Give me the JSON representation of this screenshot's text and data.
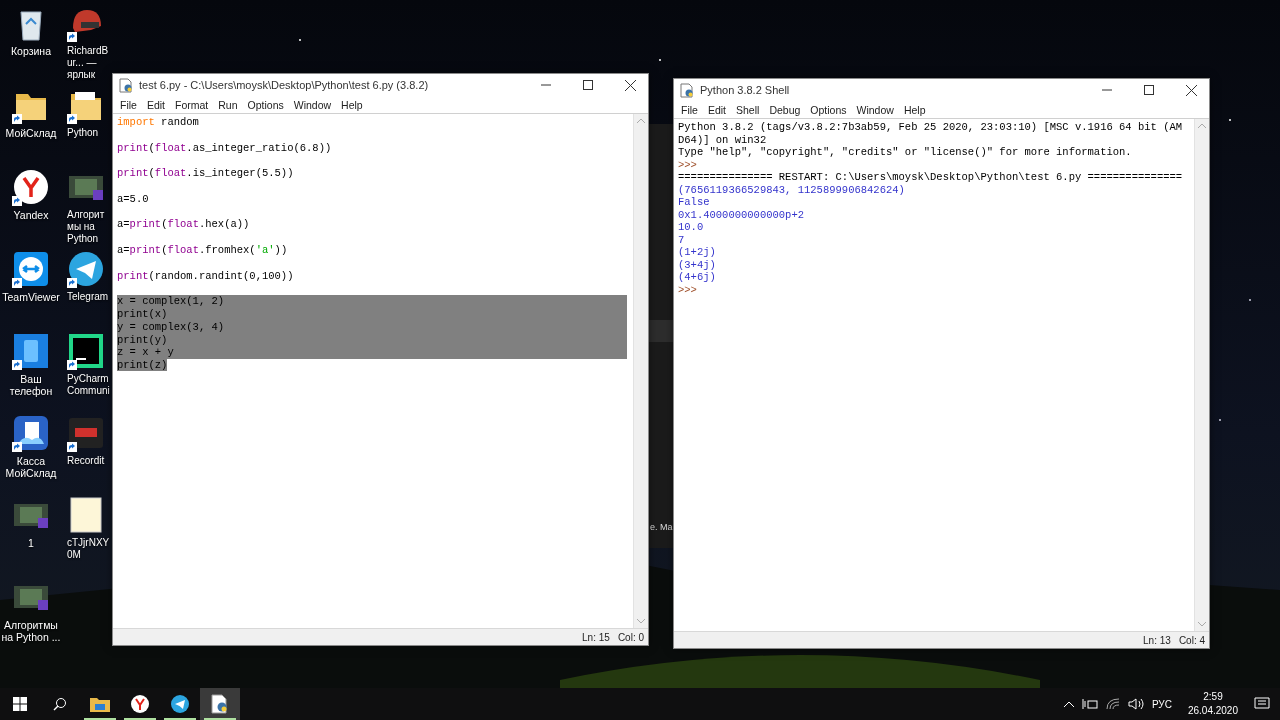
{
  "desktop": {
    "icons": [
      {
        "label": "Корзина",
        "shortcut": false
      },
      {
        "label": "МойСклад",
        "shortcut": true
      },
      {
        "label": "Yandex",
        "shortcut": true
      },
      {
        "label": "TeamViewer",
        "shortcut": true
      },
      {
        "label": "Ваш телефон",
        "shortcut": true
      },
      {
        "label": "Касса МойСклад",
        "shortcut": true
      },
      {
        "label": "1",
        "shortcut": false
      },
      {
        "label": "Алгоритмы на Python ...",
        "shortcut": false
      },
      {
        "label": "RichardBur... — ярлык",
        "shortcut": true
      },
      {
        "label": "Python",
        "shortcut": true
      },
      {
        "label": "Алгоритмы на Python",
        "shortcut": false
      },
      {
        "label": "Telegram",
        "shortcut": true
      },
      {
        "label": "PyCharm Communi",
        "shortcut": true
      },
      {
        "label": "Recordit",
        "shortcut": true
      },
      {
        "label": "cTJjrNXY0M",
        "shortcut": false
      }
    ]
  },
  "background_window": {
    "text": "e. Ma"
  },
  "editor": {
    "title": "test 6.py - C:\\Users\\moysk\\Desktop\\Python\\test 6.py (3.8.2)",
    "menu": [
      "File",
      "Edit",
      "Format",
      "Run",
      "Options",
      "Window",
      "Help"
    ],
    "blocks": [
      {
        "lines": [
          {
            "selected": false,
            "tokens": [
              {
                "text": "import",
                "kind": "keyword"
              },
              {
                "text": " random",
                "kind": "plain"
              }
            ]
          }
        ]
      },
      {
        "lines": [
          {
            "selected": false,
            "tokens": [
              {
                "text": "print",
                "kind": "builtin"
              },
              {
                "text": "(",
                "kind": "plain"
              },
              {
                "text": "float",
                "kind": "builtin"
              },
              {
                "text": ".as_integer_ratio(6.8))",
                "kind": "plain"
              }
            ]
          }
        ]
      },
      {
        "lines": [
          {
            "selected": false,
            "tokens": [
              {
                "text": "print",
                "kind": "builtin"
              },
              {
                "text": "(",
                "kind": "plain"
              },
              {
                "text": "float",
                "kind": "builtin"
              },
              {
                "text": ".is_integer(5.5))",
                "kind": "plain"
              }
            ]
          }
        ]
      },
      {
        "lines": [
          {
            "selected": false,
            "tokens": [
              {
                "text": "a=5.0",
                "kind": "plain"
              }
            ]
          }
        ]
      },
      {
        "lines": [
          {
            "selected": false,
            "tokens": [
              {
                "text": "a=",
                "kind": "plain"
              },
              {
                "text": "print",
                "kind": "builtin"
              },
              {
                "text": "(",
                "kind": "plain"
              },
              {
                "text": "float",
                "kind": "builtin"
              },
              {
                "text": ".hex(a))",
                "kind": "plain"
              }
            ]
          }
        ]
      },
      {
        "lines": [
          {
            "selected": false,
            "tokens": [
              {
                "text": "a=",
                "kind": "plain"
              },
              {
                "text": "print",
                "kind": "builtin"
              },
              {
                "text": "(",
                "kind": "plain"
              },
              {
                "text": "float",
                "kind": "builtin"
              },
              {
                "text": ".fromhex(",
                "kind": "plain"
              },
              {
                "text": "'a'",
                "kind": "string"
              },
              {
                "text": "))",
                "kind": "plain"
              }
            ]
          }
        ]
      },
      {
        "lines": [
          {
            "selected": false,
            "tokens": [
              {
                "text": "print",
                "kind": "builtin"
              },
              {
                "text": "(random.randint(0,100))",
                "kind": "plain"
              }
            ]
          }
        ]
      },
      {
        "lines": [
          {
            "selected": true,
            "tokens": [
              {
                "text": "x = complex(1, 2)",
                "kind": "plain"
              }
            ]
          },
          {
            "selected": true,
            "tokens": [
              {
                "text": "print(x)",
                "kind": "plain"
              }
            ]
          },
          {
            "selected": true,
            "tokens": [
              {
                "text": "y = complex(3, 4)",
                "kind": "plain"
              }
            ]
          },
          {
            "selected": true,
            "tokens": [
              {
                "text": "print(y)",
                "kind": "plain"
              }
            ]
          },
          {
            "selected": true,
            "tokens": [
              {
                "text": "z = x + y",
                "kind": "plain"
              }
            ]
          },
          {
            "selected": true,
            "tokens": [
              {
                "text": "print(z)",
                "kind": "plain"
              }
            ]
          }
        ]
      }
    ],
    "status": {
      "line": "Ln: 15",
      "col": "Col: 0"
    }
  },
  "shell": {
    "title": "Python 3.8.2 Shell",
    "menu": [
      "File",
      "Edit",
      "Shell",
      "Debug",
      "Options",
      "Window",
      "Help"
    ],
    "lines": [
      {
        "text": "Python 3.8.2 (tags/v3.8.2:7b3ab59, Feb 25 2020, 23:03:10) [MSC v.1916 64 bit (AM",
        "kind": "plain"
      },
      {
        "text": "D64)] on win32",
        "kind": "plain"
      },
      {
        "text": "Type \"help\", \"copyright\", \"credits\" or \"license()\" for more information.",
        "kind": "plain"
      },
      {
        "text": ">>>",
        "kind": "prompt"
      },
      {
        "text": "=============== RESTART: C:\\Users\\moysk\\Desktop\\Python\\test 6.py ===============",
        "kind": "plain"
      },
      {
        "text": "(7656119366529843, 1125899906842624)",
        "kind": "output"
      },
      {
        "text": "False",
        "kind": "output"
      },
      {
        "text": "0x1.4000000000000p+2",
        "kind": "output"
      },
      {
        "text": "10.0",
        "kind": "output"
      },
      {
        "text": "7",
        "kind": "output"
      },
      {
        "text": "(1+2j)",
        "kind": "output"
      },
      {
        "text": "(3+4j)",
        "kind": "output"
      },
      {
        "text": "(4+6j)",
        "kind": "output"
      },
      {
        "text": ">>>",
        "kind": "prompt"
      }
    ],
    "status": {
      "line": "Ln: 13",
      "col": "Col: 4"
    }
  },
  "taskbar": {
    "apps": [
      {
        "selected": false
      },
      {
        "selected": false
      },
      {
        "selected": false
      },
      {
        "selected": true
      }
    ],
    "language": "РУС",
    "time": "2:59",
    "date": "26.04.2020"
  }
}
